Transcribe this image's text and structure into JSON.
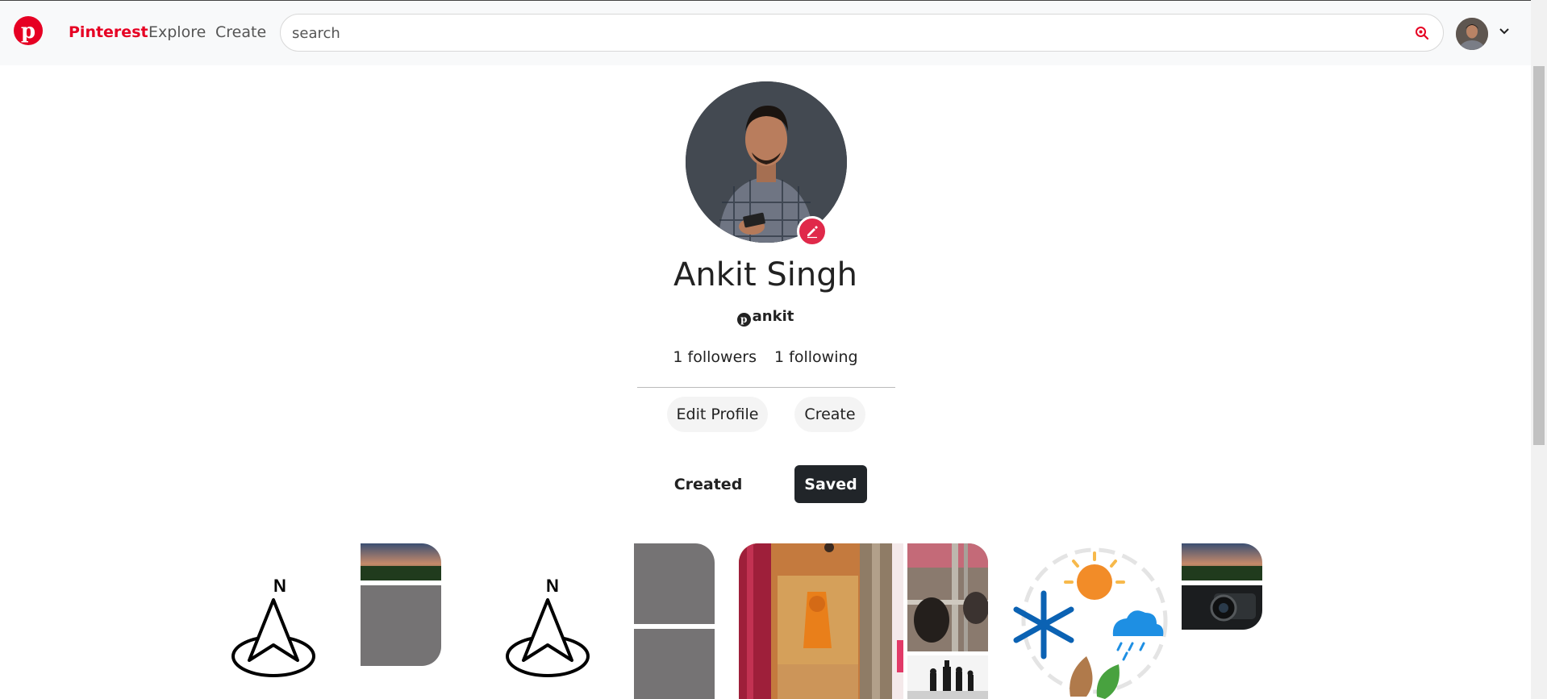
{
  "nav": {
    "logo_letter": "p",
    "brand": "Pinterest",
    "explore": "Explore",
    "create": "Create"
  },
  "search": {
    "placeholder": "search",
    "value": ""
  },
  "profile": {
    "name": "Ankit Singh",
    "handle": "ankit",
    "followers": "1 followers",
    "following": "1 following",
    "edit_profile_label": "Edit Profile",
    "create_label": "Create"
  },
  "tabs": {
    "created": "Created",
    "saved": "Saved",
    "active": "Saved"
  },
  "boards": {
    "compass_letter": "N"
  },
  "colors": {
    "brand_red": "#e60023",
    "edit_badge": "#e0294a",
    "saved_tab_bg": "#212529",
    "tile_gray": "#757374"
  },
  "icons": [
    "pinterest-logo-icon",
    "search-icon",
    "chevron-down-icon",
    "pencil-icon",
    "compass-north-icon",
    "weather-icon"
  ]
}
